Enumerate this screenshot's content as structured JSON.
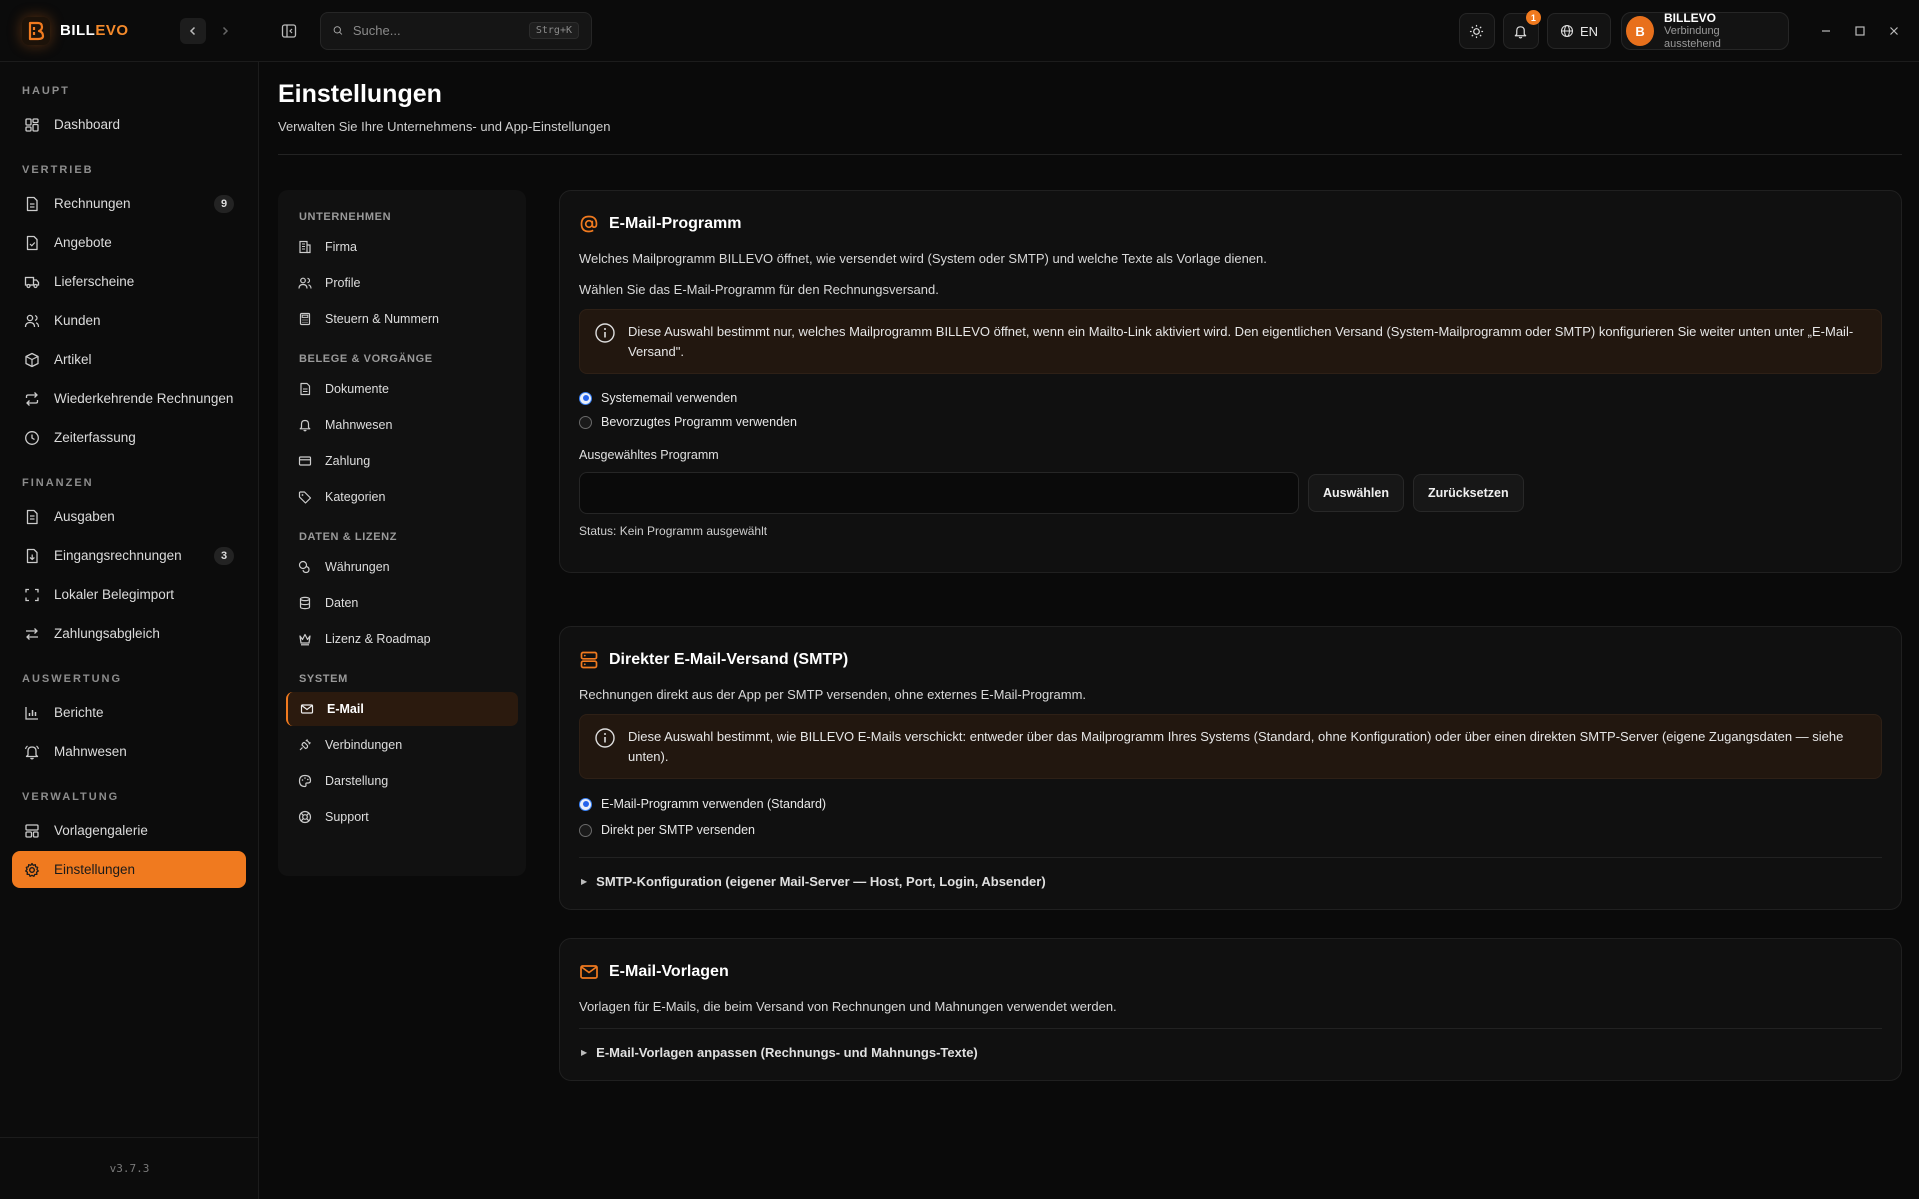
{
  "app": {
    "brand_prefix": "BILL",
    "brand_suffix": "EVO",
    "version": "v3.7.3"
  },
  "topbar": {
    "search_placeholder": "Suche...",
    "search_shortcut": "Strg+K",
    "notification_count": "1",
    "language": "EN",
    "user_initial": "B",
    "user_name": "BILLEVO",
    "user_status": "Verbindung ausstehend"
  },
  "sidebar": {
    "sections": [
      {
        "title": "HAUPT",
        "items": [
          {
            "label": "Dashboard"
          }
        ]
      },
      {
        "title": "VERTRIEB",
        "items": [
          {
            "label": "Rechnungen",
            "badge": "9"
          },
          {
            "label": "Angebote"
          },
          {
            "label": "Lieferscheine"
          },
          {
            "label": "Kunden"
          },
          {
            "label": "Artikel"
          },
          {
            "label": "Wiederkehrende Rechnungen"
          },
          {
            "label": "Zeiterfassung"
          }
        ]
      },
      {
        "title": "FINANZEN",
        "items": [
          {
            "label": "Ausgaben"
          },
          {
            "label": "Eingangsrechnungen",
            "badge": "3"
          },
          {
            "label": "Lokaler Belegimport"
          },
          {
            "label": "Zahlungsabgleich"
          }
        ]
      },
      {
        "title": "AUSWERTUNG",
        "items": [
          {
            "label": "Berichte"
          },
          {
            "label": "Mahnwesen"
          }
        ]
      },
      {
        "title": "VERWALTUNG",
        "items": [
          {
            "label": "Vorlagengalerie"
          },
          {
            "label": "Einstellungen"
          }
        ]
      }
    ]
  },
  "page": {
    "title": "Einstellungen",
    "subtitle": "Verwalten Sie Ihre Unternehmens- und App-Einstellungen"
  },
  "settings_nav": {
    "sections": [
      {
        "title": "UNTERNEHMEN",
        "items": [
          {
            "label": "Firma"
          },
          {
            "label": "Profile"
          },
          {
            "label": "Steuern & Nummern"
          }
        ]
      },
      {
        "title": "BELEGE & VORGÄNGE",
        "items": [
          {
            "label": "Dokumente"
          },
          {
            "label": "Mahnwesen"
          },
          {
            "label": "Zahlung"
          },
          {
            "label": "Kategorien"
          }
        ]
      },
      {
        "title": "DATEN & LIZENZ",
        "items": [
          {
            "label": "Währungen"
          },
          {
            "label": "Daten"
          },
          {
            "label": "Lizenz & Roadmap"
          }
        ]
      },
      {
        "title": "SYSTEM",
        "items": [
          {
            "label": "E-Mail"
          },
          {
            "label": "Verbindungen"
          },
          {
            "label": "Darstellung"
          },
          {
            "label": "Support"
          }
        ]
      }
    ]
  },
  "email_program": {
    "title": "E-Mail-Programm",
    "description": "Welches Mailprogramm BILLEVO öffnet, wie versendet wird (System oder SMTP) und welche Texte als Vorlage dienen.",
    "prompt": "Wählen Sie das E-Mail-Programm für den Rechnungsversand.",
    "info": "Diese Auswahl bestimmt nur, welches Mailprogramm BILLEVO öffnet, wenn ein Mailto-Link aktiviert wird. Den eigentlichen Versand (System-Mailprogramm oder SMTP) konfigurieren Sie weiter unten unter „E-Mail-Versand\".",
    "option_system": "Systememail verwenden",
    "option_preferred": "Bevorzugtes Programm verwenden",
    "selected_label": "Ausgewähltes Programm",
    "selected_value": "",
    "select_button": "Auswählen",
    "reset_button": "Zurücksetzen",
    "status": "Status: Kein Programm ausgewählt"
  },
  "smtp": {
    "title": "Direkter E-Mail-Versand (SMTP)",
    "description": "Rechnungen direkt aus der App per SMTP versenden, ohne externes E-Mail-Programm.",
    "info": "Diese Auswahl bestimmt, wie BILLEVO E-Mails verschickt: entweder über das Mailprogramm Ihres Systems (Standard, ohne Konfiguration) oder über einen direkten SMTP-Server (eigene Zugangsdaten — siehe unten).",
    "option_default": "E-Mail-Programm verwenden (Standard)",
    "option_smtp": "Direkt per SMTP versenden",
    "config_toggle": "SMTP-Konfiguration (eigener Mail-Server — Host, Port, Login, Absender)"
  },
  "templates": {
    "title": "E-Mail-Vorlagen",
    "description": "Vorlagen für E-Mails, die beim Versand von Rechnungen und Mahnungen verwendet werden.",
    "toggle": "E-Mail-Vorlagen anpassen (Rechnungs- und Mahnungs-Texte)"
  },
  "colors": {
    "accent": "#f07a1f",
    "background": "#0a0a0a",
    "card": "#101010",
    "info_bg": "#22170f"
  }
}
